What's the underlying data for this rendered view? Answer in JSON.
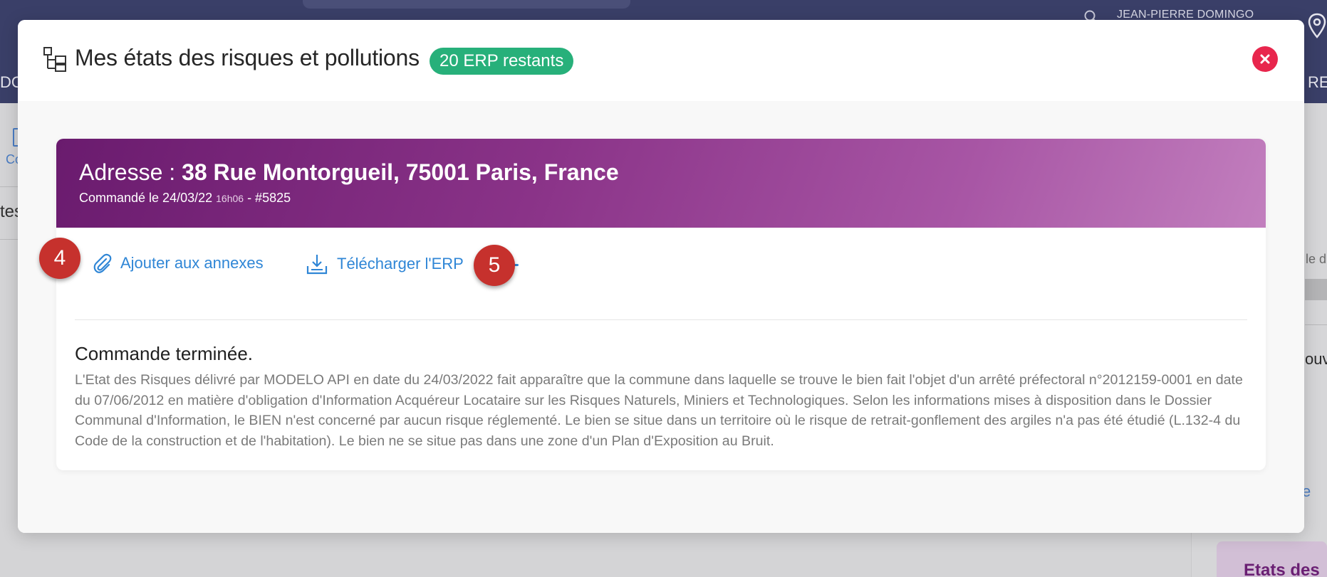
{
  "background": {
    "user_name": "JEAN-PIERRE DOMINGO",
    "nav_left_partial": "DO",
    "nav_right_partial": "RE",
    "left_label_partial": "Co",
    "left_text_partial": "tes",
    "right_text1_partial": "le d",
    "right_text2_partial": "ouv",
    "right_link_partial": "e",
    "right_card_title_partial": "Etats des"
  },
  "modal": {
    "title": "Mes états des risques et pollutions",
    "badge": "20 ERP restants",
    "close_icon": "close-icon"
  },
  "card": {
    "address_label": "Adresse : ",
    "address_value": "38 Rue Montorgueil, 75001 Paris, France",
    "ordered_prefix": "Commandé le 24/03/22 ",
    "ordered_time": "16h06",
    "ordered_suffix": " - #5825"
  },
  "actions": {
    "add_annex": "Ajouter aux annexes",
    "download": "Télécharger l'ERP"
  },
  "status": {
    "title": "Commande terminée.",
    "text": "L'Etat des Risques délivré par MODELO API en date du 24/03/2022 fait apparaître que la commune dans laquelle se trouve le bien fait l'objet d'un arrêté préfectoral n°2012159-0001 en date du 07/06/2012 en matière d'obligation d'Information Acquéreur Locataire sur les Risques Naturels, Miniers et Technologiques. Selon les informations mises à disposition dans le Dossier Communal d'Information, le BIEN n'est concerné par aucun risque réglementé. Le bien se situe dans un territoire où le risque de retrait-gonflement des argiles n'a pas été étudié (L.132-4 du Code de la construction et de l'habitation). Le bien ne se situe pas dans une zone d'un Plan d'Exposition au Bruit."
  },
  "markers": {
    "m4": "4",
    "m5": "5"
  },
  "colors": {
    "badge": "#27b07a",
    "close": "#e8264d",
    "link": "#2f86d6",
    "marker": "#c6312d",
    "header_gradient_start": "#6a1b6e",
    "header_gradient_end": "#c27fbe"
  }
}
